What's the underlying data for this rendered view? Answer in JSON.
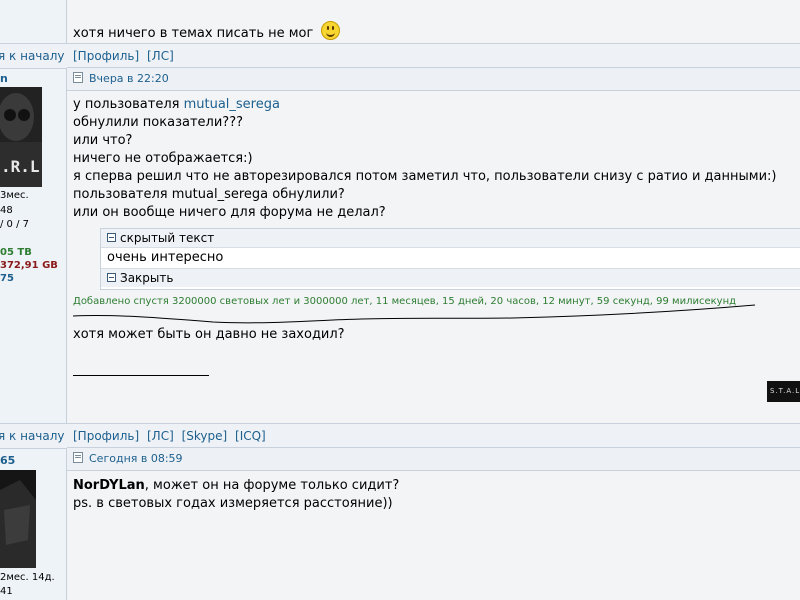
{
  "top_post": {
    "text": "хотя ничего в темах писать не мог"
  },
  "bar1": {
    "back_link": "я к началу",
    "profile": "[Профиль]",
    "pm": "[ЛС]"
  },
  "post1": {
    "author_fragment": "n",
    "date": "Вчера в 22:20",
    "user_info": {
      "line1": "3мес.",
      "line2": "48",
      "line3": "/ 0 / 7",
      "upload": "05 TB",
      "download": "372,91 GB",
      "ratio": "75"
    },
    "line1_prefix": "у пользователя ",
    "line1_user": "mutual_serega",
    "lines": [
      "обнулили показатели???",
      "или что?",
      "ничего не отображается:)",
      "я сперва решил что не авторезировался потом заметил что, пользователи снизу с ратио и данными:)",
      "пользователя mutual_serega обнулили?",
      "или он вообще ничего для форума не делал?"
    ],
    "spoiler": {
      "title": "скрытый текст",
      "body": "очень интересно",
      "close": "Закрыть"
    },
    "added_note": "Добавлено спустя 3200000 световых лет и 3000000 лет, 11 месяцев, 15 дней, 20 часов, 12 минут, 59 секунд, 99 милисекунд",
    "after_text": "хотя может быть он давно не заходил?",
    "signature_banner": "S.T.A.L"
  },
  "bar2": {
    "back_link": "я к началу",
    "profile": "[Профиль]",
    "pm": "[ЛС]",
    "skype": "[Skype]",
    "icq": "[ICQ]"
  },
  "post2": {
    "author_fragment": "65",
    "date": "Сегодня в 08:59",
    "user_info": {
      "line1": "2мес. 14д.",
      "line2": "41"
    },
    "reply_name": "NorDYLan",
    "reply_text": ", может он на форуме только сидит?",
    "line2": "ps. в световых годах измеряется расстояние))"
  },
  "colors": {
    "link": "#1d5f8e",
    "added_note": "#2e7d32",
    "upload": "#2e7d32",
    "download": "#8b1a1a"
  }
}
